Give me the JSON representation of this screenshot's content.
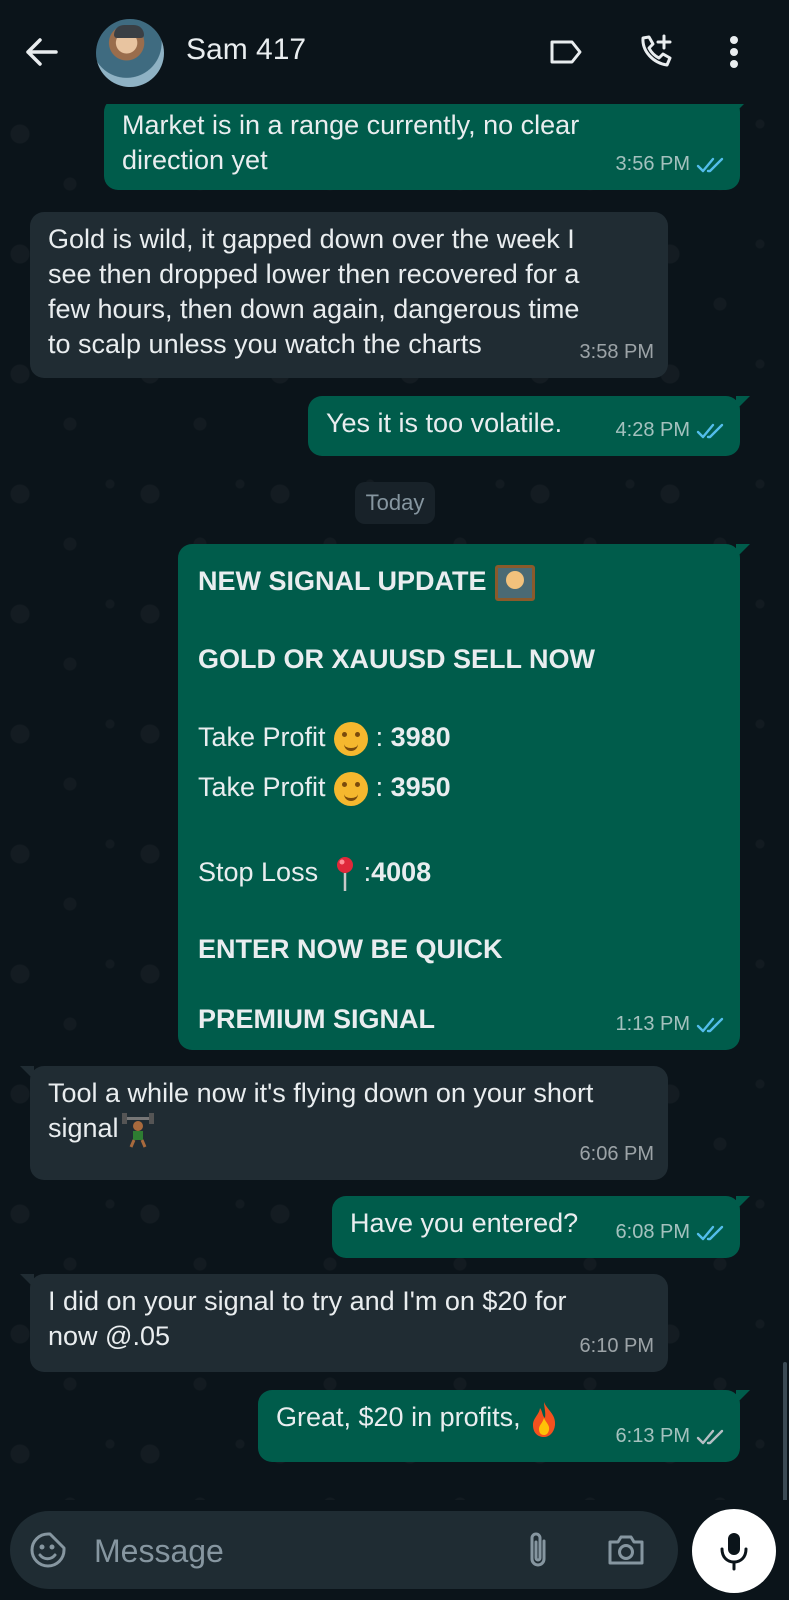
{
  "header": {
    "contact_name": "Sam 417",
    "icons": [
      "back-arrow-icon",
      "label-icon",
      "add-call-icon",
      "more-vert-icon"
    ]
  },
  "colors": {
    "background": "#0b141a",
    "outgoing_bubble": "#005c4b",
    "incoming_bubble": "#202c33",
    "read_tick": "#53bdeb"
  },
  "messages": [
    {
      "direction": "out",
      "text": "Market is in a range currently, no clear\ndirection yet",
      "time": "3:56 PM",
      "read": true
    },
    {
      "direction": "in",
      "text": "Gold is wild, it gapped down over the week I\nsee then dropped lower then recovered for a\nfew hours, then down again, dangerous time\nto scalp unless you watch the charts",
      "time": "3:58 PM"
    },
    {
      "direction": "out",
      "text": "Yes it is too volatile.",
      "time": "4:28 PM",
      "read": true
    },
    {
      "direction": "out",
      "type": "signal",
      "time": "1:13 PM",
      "read": true
    },
    {
      "direction": "in",
      "text": "Tool a while now it's flying down on your short\nsignal",
      "time": "6:06 PM"
    },
    {
      "direction": "out",
      "text": "Have you entered?",
      "time": "6:08 PM",
      "read": true
    },
    {
      "direction": "in",
      "text": "I did on your signal to try and I'm on $20 for\nnow @.05",
      "time": "6:10 PM"
    },
    {
      "direction": "out",
      "text": "Great, $20 in profits,",
      "time": "6:13 PM",
      "read": false
    }
  ],
  "date_divider": "Today",
  "signal": {
    "title": "NEW SIGNAL UPDATE",
    "instruction": "GOLD OR XAUUSD SELL NOW",
    "tp1_label": "Take Profit",
    "tp1_value": "3980",
    "tp2_label": "Take Profit",
    "tp2_value": "3950",
    "sl_label": "Stop Loss",
    "sl_value": "4008",
    "separator": ":",
    "cta": "ENTER NOW BE QUICK",
    "footer": "PREMIUM SIGNAL"
  },
  "composer": {
    "placeholder": "Message",
    "icons": [
      "sticker-icon",
      "attach-icon",
      "camera-icon",
      "mic-icon"
    ]
  }
}
